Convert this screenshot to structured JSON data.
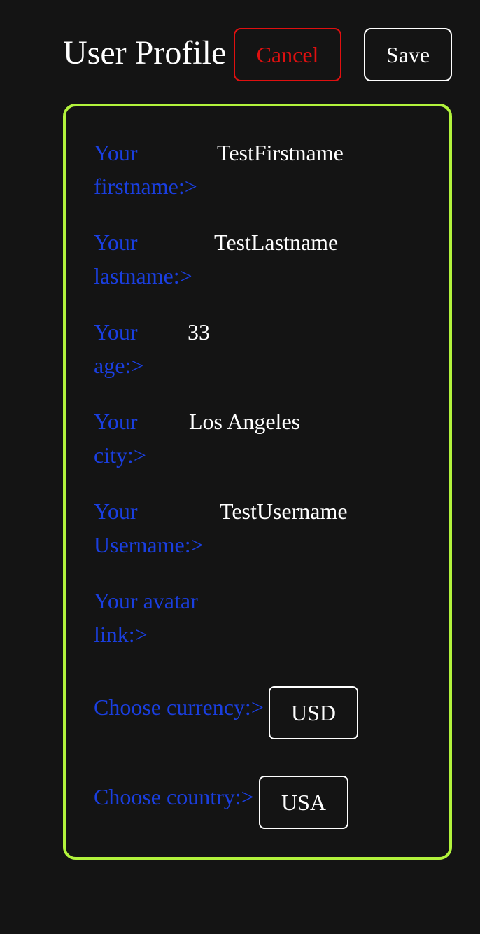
{
  "header": {
    "title": "User Profile",
    "cancel_label": "Cancel",
    "save_label": "Save"
  },
  "form": {
    "firstname": {
      "label_line1": "Your",
      "label_line2": "firstname:>",
      "value": "TestFirstname"
    },
    "lastname": {
      "label_line1": "Your",
      "label_line2": "lastname:>",
      "value": "TestLastname"
    },
    "age": {
      "label_line1": "Your",
      "label_line2": "age:>",
      "value": "33"
    },
    "city": {
      "label_line1": "Your",
      "label_line2": "city:>",
      "value": "Los Angeles"
    },
    "username": {
      "label_line1": "Your",
      "label_line2": "Username:>",
      "value": "TestUsername"
    },
    "avatar": {
      "label_line1": "Your avatar",
      "label_line2": "link:>",
      "value": ""
    },
    "currency": {
      "label": "Choose currency:>",
      "value": "USD"
    },
    "country": {
      "label": "Choose country:>",
      "value": "USA"
    }
  },
  "colors": {
    "background": "#141414",
    "label": "#1a3fe0",
    "value": "#ffffff",
    "card_border": "#b2f33c",
    "cancel": "#e01010"
  }
}
